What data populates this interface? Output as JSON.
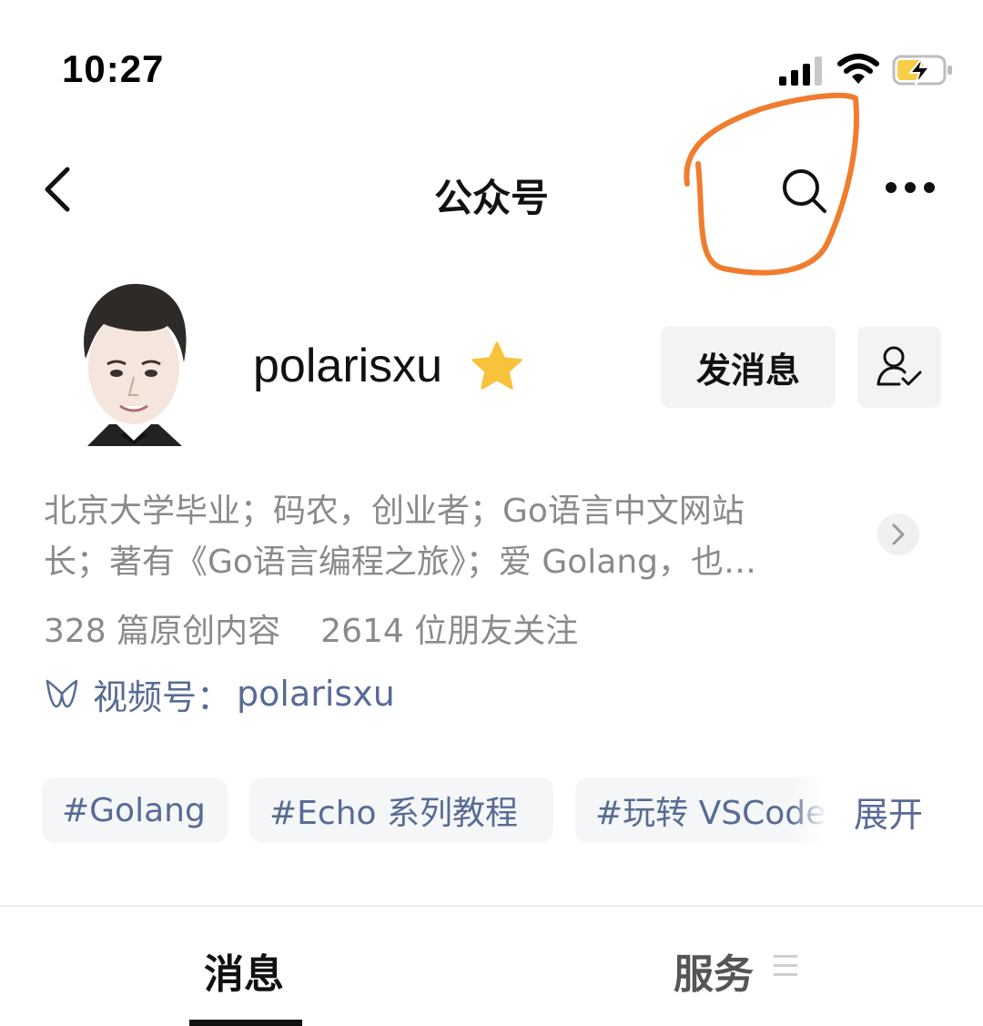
{
  "status_bar": {
    "time": "10:27",
    "icons": [
      "signal-icon",
      "wifi-icon",
      "battery-charging-icon"
    ],
    "battery_color": "#f7ce46"
  },
  "nav": {
    "title": "公众号",
    "back_icon": "chevron-left-icon",
    "search_icon": "search-icon",
    "more_icon": "ellipsis-icon"
  },
  "annotation": {
    "color": "#f07d2e",
    "shape": "hand-drawn loop around search icon"
  },
  "profile": {
    "name": "polarisxu",
    "verified_icon": "star-icon",
    "star_color": "#f8c33a",
    "message_button": "发消息",
    "follow_icon": "user-check-icon",
    "bio_line_1": "北京大学毕业；码农，创业者；Go语言中文网站",
    "bio_line_2": "长；著有《Go语言编程之旅》；爱 Golang，也…",
    "original_count": "328 篇原创内容",
    "follower_count": "2614 位朋友关注",
    "channel_label": "视频号：",
    "channel_name": "polarisxu",
    "link_color": "#576b95"
  },
  "tags": {
    "items": [
      "#Golang",
      "#Echo 系列教程",
      "#玩转 VSCode"
    ],
    "expand": "展开"
  },
  "tabs": {
    "messages": "消息",
    "services": "服务",
    "services_icon": "menu-icon"
  }
}
